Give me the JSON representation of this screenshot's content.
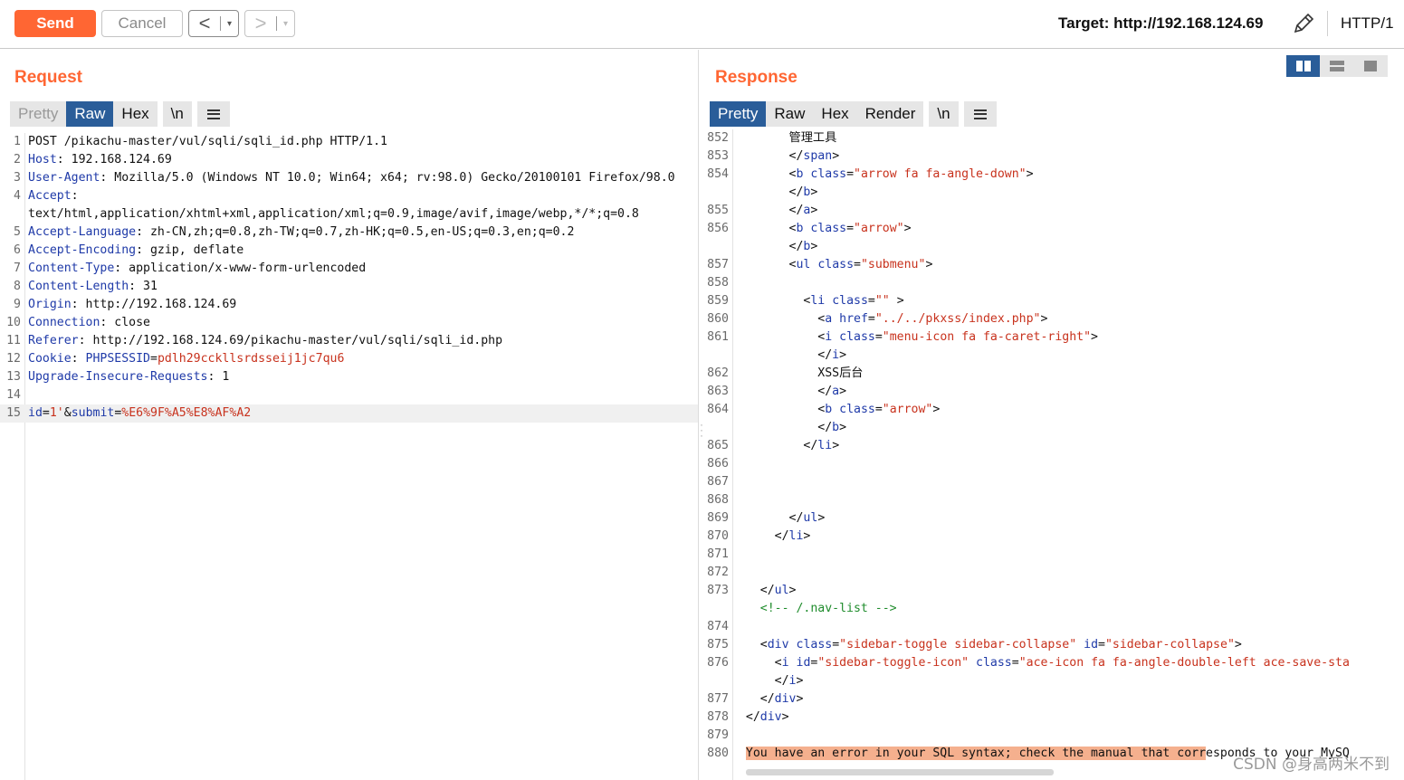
{
  "toolbar": {
    "send_label": "Send",
    "cancel_label": "Cancel",
    "back_glyph": "<",
    "forward_glyph": ">",
    "dropdown_glyph": "▾",
    "target_label": "Target: http://192.168.124.69",
    "edit_icon": "pencil-icon",
    "protocol_label": "HTTP/1",
    "accent_color": "#ff6633"
  },
  "request": {
    "title": "Request",
    "tabs": [
      "Pretty",
      "Raw",
      "Hex",
      "\\n"
    ],
    "active_tab": "Raw"
  },
  "response": {
    "title": "Response",
    "tabs": [
      "Pretty",
      "Raw",
      "Hex",
      "Render",
      "\\n"
    ],
    "active_tab": "Pretty"
  },
  "watermark": "CSDN @身高两米不到"
}
